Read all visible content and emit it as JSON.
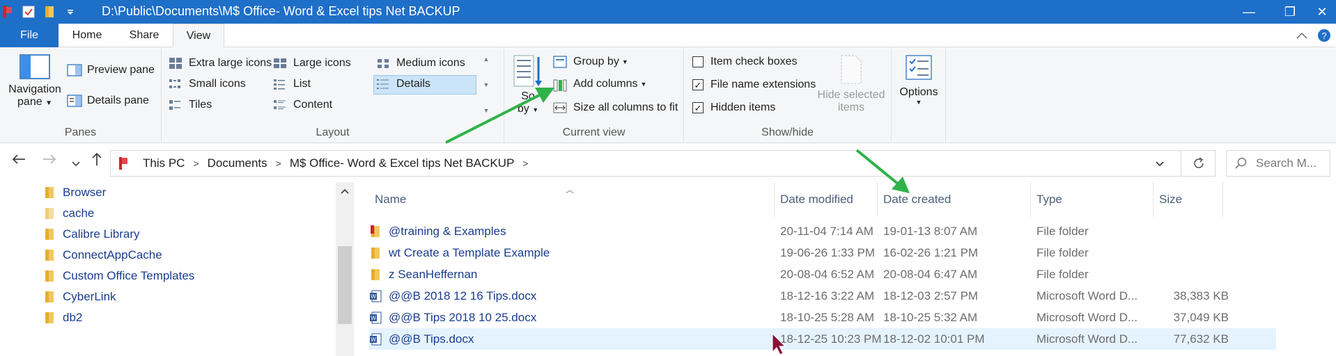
{
  "window": {
    "title": "D:\\Public\\Documents\\M$ Office- Word & Excel tips Net BACKUP",
    "minimize": "—",
    "maximize": "❐",
    "close": "✕"
  },
  "tabs": [
    {
      "label": "File"
    },
    {
      "label": "Home"
    },
    {
      "label": "Share"
    },
    {
      "label": "View"
    }
  ],
  "ribbon": {
    "panes": {
      "navigation_pane": "Navigation",
      "navigation_pane_2": "pane",
      "preview_pane": "Preview pane",
      "details_pane": "Details pane",
      "label": "Panes"
    },
    "layout": {
      "items": [
        {
          "label": "Extra large icons"
        },
        {
          "label": "Large icons"
        },
        {
          "label": "Medium icons"
        },
        {
          "label": "Small icons"
        },
        {
          "label": "List"
        },
        {
          "label": "Details"
        },
        {
          "label": "Tiles"
        },
        {
          "label": "Content"
        }
      ],
      "label": "Layout"
    },
    "current_view": {
      "sort_by_1": "So",
      "sort_by_2": "by",
      "group_by": "Group by",
      "add_columns": "Add columns",
      "size_all_columns": "Size all columns to fit",
      "label": "Current view"
    },
    "show_hide": {
      "item_check_boxes": "Item check boxes",
      "file_name_extensions": "File name extensions",
      "hidden_items": "Hidden items",
      "hide_selected_1": "Hide selected",
      "hide_selected_2": "items",
      "label": "Show/hide",
      "checked": {
        "item_check_boxes": false,
        "file_name_extensions": true,
        "hidden_items": true
      }
    },
    "options": {
      "label": "Options"
    }
  },
  "address": {
    "crumbs": [
      "This PC",
      "Documents",
      "M$ Office- Word & Excel tips Net BACKUP"
    ],
    "search_placeholder": "Search M..."
  },
  "nav_pane": {
    "items": [
      "Browser",
      "cache",
      "Calibre Library",
      "ConnectAppCache",
      "Custom Office Templates",
      "CyberLink",
      "db2"
    ]
  },
  "file_list": {
    "columns": {
      "name": "Name",
      "date_modified": "Date modified",
      "date_created": "Date created",
      "type": "Type",
      "size": "Size"
    },
    "rows": [
      {
        "name": "@training & Examples",
        "modified": "20-11-04 7:14 AM",
        "created": "19-01-13 8:07 AM",
        "type": "File folder",
        "size": "",
        "icon": "red-folder-icon"
      },
      {
        "name": "wt Create a Template Example",
        "modified": "19-06-26 1:33 PM",
        "created": "16-02-26 1:21 PM",
        "type": "File folder",
        "size": "",
        "icon": "folder-icon"
      },
      {
        "name": "z SeanHeffernan",
        "modified": "20-08-04 6:52 AM",
        "created": "20-08-04 6:47 AM",
        "type": "File folder",
        "size": "",
        "icon": "folder-icon"
      },
      {
        "name": "@@B 2018 12 16 Tips.docx",
        "modified": "18-12-16 3:22 AM",
        "created": "18-12-03 2:57 PM",
        "type": "Microsoft Word D...",
        "size": "38,383 KB",
        "icon": "word-doc-icon"
      },
      {
        "name": "@@B Tips 2018 10 25.docx",
        "modified": "18-10-25 5:28 AM",
        "created": "18-10-25 5:32 AM",
        "type": "Microsoft Word D...",
        "size": "37,049 KB",
        "icon": "word-doc-icon"
      },
      {
        "name": "@@B Tips.docx",
        "modified": "18-12-25 10:23 PM",
        "created": "18-12-02 10:01 PM",
        "type": "Microsoft Word D...",
        "size": "77,632 KB",
        "icon": "word-doc-icon"
      }
    ]
  },
  "colors": {
    "accent": "#1e6fc8",
    "annotation_arrow": "#2eb34a",
    "selection": "#e5f3ff"
  }
}
